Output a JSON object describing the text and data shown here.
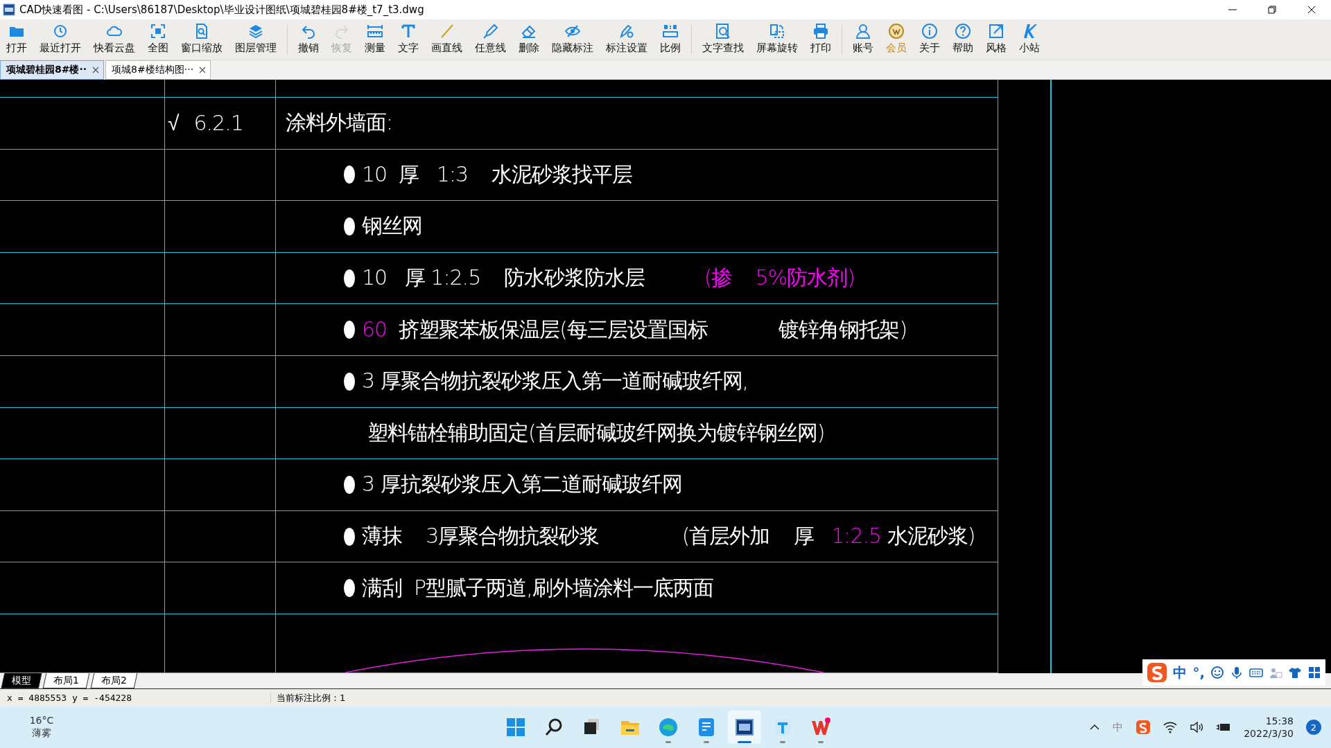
{
  "window": {
    "title": "CAD快速看图 - C:\\Users\\86187\\Desktop\\毕业设计图纸\\项城碧桂园8#楼_t7_t3.dwg"
  },
  "toolbar": {
    "groups": [
      [
        {
          "label": "打开",
          "disabled": false,
          "kind": "tool"
        },
        {
          "label": "最近打开",
          "disabled": false,
          "kind": "tool"
        },
        {
          "label": "快看云盘",
          "disabled": false,
          "kind": "tool"
        },
        {
          "label": "全图",
          "disabled": false,
          "kind": "tool"
        },
        {
          "label": "窗口缩放",
          "disabled": false,
          "kind": "tool"
        },
        {
          "label": "图层管理",
          "disabled": false,
          "kind": "tool"
        }
      ],
      [
        {
          "label": "撤销",
          "disabled": false,
          "kind": "tool"
        },
        {
          "label": "恢复",
          "disabled": true,
          "kind": "tool"
        },
        {
          "label": "测量",
          "disabled": false,
          "kind": "tool"
        },
        {
          "label": "文字",
          "disabled": false,
          "kind": "tool"
        },
        {
          "label": "画直线",
          "disabled": false,
          "kind": "tool"
        },
        {
          "label": "任意线",
          "disabled": false,
          "kind": "tool"
        },
        {
          "label": "删除",
          "disabled": false,
          "kind": "tool"
        },
        {
          "label": "隐藏标注",
          "disabled": false,
          "kind": "tool"
        },
        {
          "label": "标注设置",
          "disabled": false,
          "kind": "tool"
        },
        {
          "label": "比例",
          "disabled": false,
          "kind": "tool"
        }
      ],
      [
        {
          "label": "文字查找",
          "disabled": false,
          "kind": "tool"
        },
        {
          "label": "屏幕旋转",
          "disabled": false,
          "kind": "tool"
        },
        {
          "label": "打印",
          "disabled": false,
          "kind": "tool"
        }
      ],
      [
        {
          "label": "账号",
          "disabled": false,
          "kind": "tool"
        },
        {
          "label": "会员",
          "disabled": false,
          "kind": "vip"
        },
        {
          "label": "关于",
          "disabled": false,
          "kind": "tool"
        },
        {
          "label": "帮助",
          "disabled": false,
          "kind": "tool"
        },
        {
          "label": "风格",
          "disabled": false,
          "kind": "tool"
        },
        {
          "label": "小站",
          "disabled": false,
          "kind": "tool"
        }
      ]
    ]
  },
  "document_tabs": [
    {
      "label": "项城碧桂园8#楼··",
      "selected": true
    },
    {
      "label": "项城8#楼结构图···",
      "selected": false
    }
  ],
  "drawing": {
    "rows": [
      {
        "kind": "heading",
        "mark": "√",
        "number": "6.2.1",
        "segments": [
          {
            "text": "涂料外墙面:",
            "color": "#ffffff"
          }
        ]
      },
      {
        "kind": "bullet",
        "segments": [
          {
            "text": "10  厚   1:3    水泥砂浆找平层",
            "color": "#ffffff"
          }
        ]
      },
      {
        "kind": "bullet",
        "segments": [
          {
            "text": "钢丝网",
            "color": "#ffffff"
          }
        ]
      },
      {
        "kind": "bullet",
        "segments": [
          {
            "text": "10   厚 1:2.5    防水砂浆防水层          ",
            "color": "#ffffff"
          },
          {
            "text": "(掺    5%防水剂)",
            "color": "#ff00ff"
          }
        ]
      },
      {
        "kind": "bullet",
        "segments": [
          {
            "text": "60",
            "color": "#ff00ff"
          },
          {
            "text": "  挤塑聚苯板保温层(每三层设置国标            镀锌角钢托架)",
            "color": "#ffffff"
          }
        ]
      },
      {
        "kind": "bullet",
        "segments": [
          {
            "text": "3 厚聚合物抗裂砂浆压入第一道耐碱玻纤网,",
            "color": "#ffffff"
          }
        ]
      },
      {
        "kind": "continuation",
        "segments": [
          {
            "text": "塑料锚栓辅助固定(首层耐碱玻纤网换为镀锌钢丝网)",
            "color": "#ffffff"
          }
        ]
      },
      {
        "kind": "bullet",
        "segments": [
          {
            "text": "3 厚抗裂砂浆压入第二道耐碱玻纤网",
            "color": "#ffffff"
          }
        ]
      },
      {
        "kind": "bullet",
        "segments": [
          {
            "text": "薄抹    3厚聚合物抗裂砂浆              (首层外加    厚   ",
            "color": "#ffffff"
          },
          {
            "text": "1:2.5",
            "color": "#ff00ff"
          },
          {
            "text": " 水泥砂浆)",
            "color": "#ffffff"
          }
        ]
      },
      {
        "kind": "bullet",
        "segments": [
          {
            "text": "满刮  P型腻子两道,刷外墙涂料一底两面",
            "color": "#ffffff"
          }
        ]
      }
    ]
  },
  "layout_tabs": [
    {
      "label": "模型",
      "selected": true
    },
    {
      "label": "布局1",
      "selected": false
    },
    {
      "label": "布局2",
      "selected": false
    }
  ],
  "ime_bar": {
    "mode": "中",
    "punctuation": "°,"
  },
  "status_bar": {
    "coordinates": "x = 4885553 y = -454228",
    "scale": "当前标注比例：1"
  },
  "taskbar": {
    "weather": {
      "temperature": "16°C",
      "condition": "薄雾"
    },
    "apps": [
      {
        "running": false,
        "selected": false
      },
      {
        "running": false,
        "selected": false
      },
      {
        "running": false,
        "selected": false
      },
      {
        "running": false,
        "selected": false
      },
      {
        "running": true,
        "selected": false
      },
      {
        "running": true,
        "selected": false
      },
      {
        "running": true,
        "selected": true
      },
      {
        "running": true,
        "selected": false
      },
      {
        "running": true,
        "selected": false
      }
    ],
    "tray": {
      "input_language": "中",
      "time": "15:38",
      "date": "2022/3/30",
      "notifications": "2"
    }
  }
}
